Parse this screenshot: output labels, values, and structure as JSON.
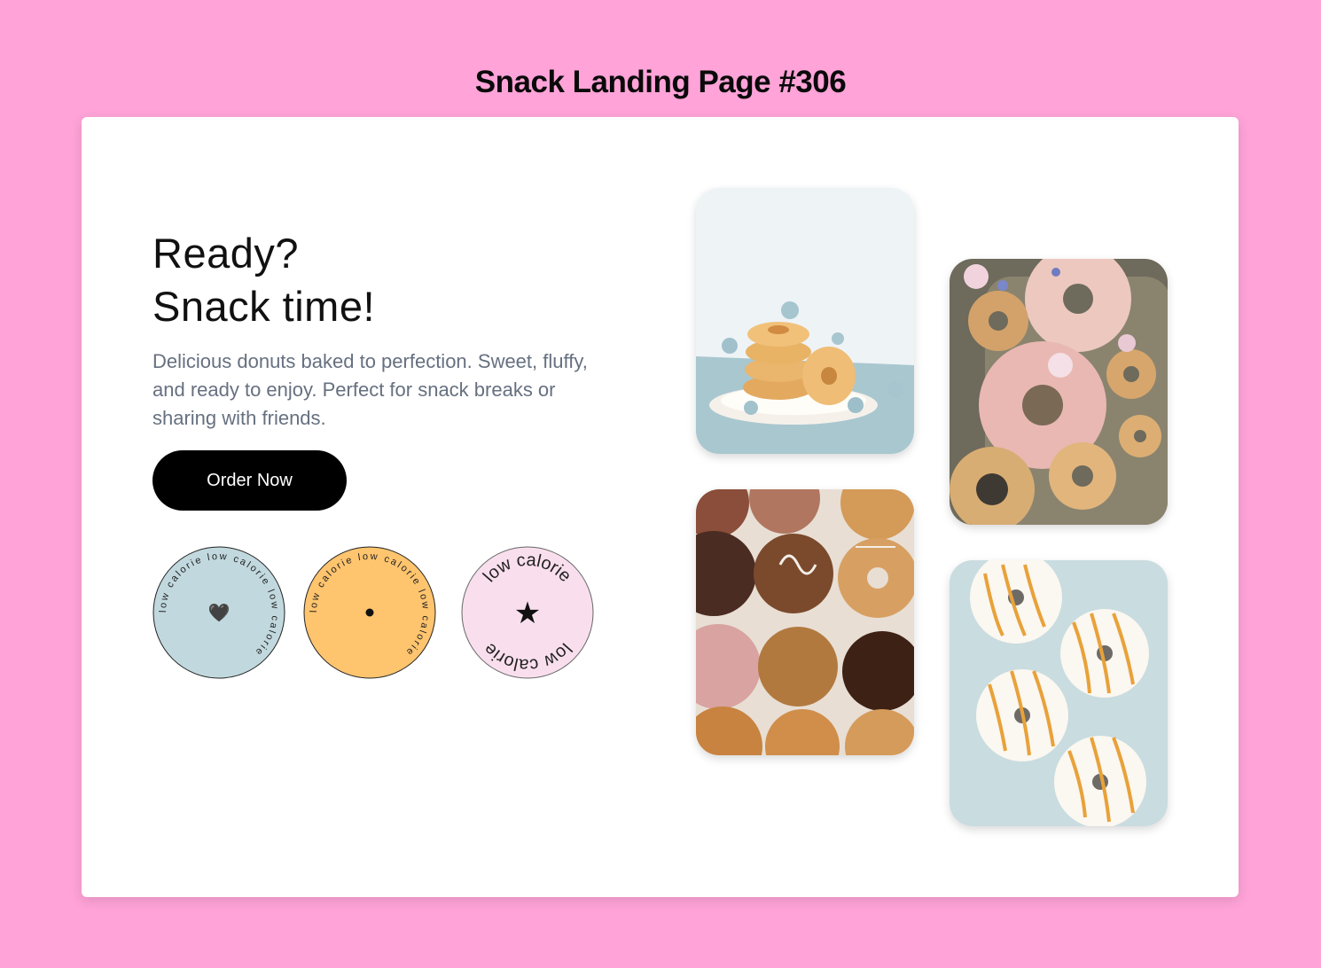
{
  "page": {
    "title": "Snack Landing Page #306"
  },
  "hero": {
    "headline_line1": "Ready?",
    "headline_line2": "Snack time!",
    "description": "Delicious donuts baked to perfection. Sweet, fluffy, and ready to enjoy. Perfect for snack breaks or sharing with friends.",
    "cta_label": "Order Now"
  },
  "badges": [
    {
      "ring_text": "low calorie low calorie low calorie",
      "center": "🖤",
      "icon": "heart-icon",
      "color": "#c1d9de"
    },
    {
      "ring_text": "low calorie low calorie low calorie",
      "center": "•",
      "icon": "dot-icon",
      "color": "#ffc46e"
    },
    {
      "ring_text_top": "low calorie",
      "ring_text_bottom": "low calorie",
      "center": "★",
      "icon": "star-icon",
      "color": "#f9dfed"
    }
  ],
  "gallery": [
    {
      "name": "stacked-glazed-donuts-photo"
    },
    {
      "name": "pink-frosted-flower-donuts-photo"
    },
    {
      "name": "assorted-donuts-box-photo"
    },
    {
      "name": "caramel-drizzle-donuts-photo"
    }
  ],
  "colors": {
    "background": "#ffa3d8",
    "card": "#ffffff",
    "button": "#000000",
    "text_muted": "#667080"
  }
}
